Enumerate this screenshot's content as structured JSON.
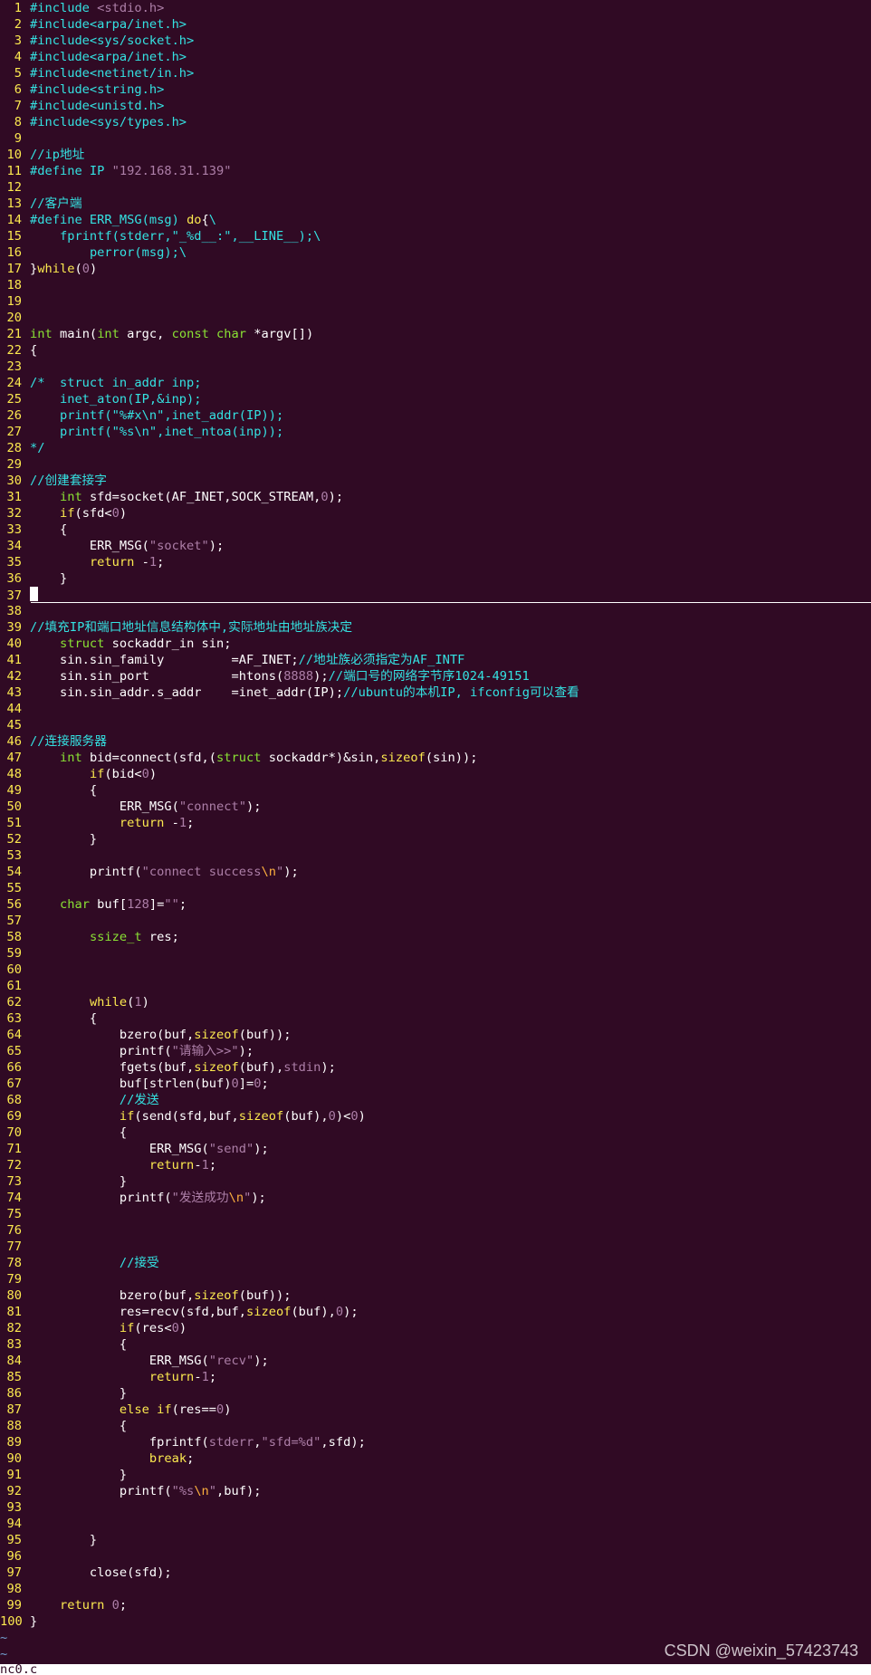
{
  "editor": {
    "filename": "nc0.c",
    "cursor_line": 37,
    "lines": [
      [
        [
          "pp",
          "#include "
        ],
        [
          "st",
          "<stdio.h>"
        ]
      ],
      [
        [
          "pp",
          "#include<arpa/inet.h>"
        ]
      ],
      [
        [
          "pp",
          "#include<sys/socket.h>"
        ]
      ],
      [
        [
          "pp",
          "#include<arpa/inet.h>"
        ]
      ],
      [
        [
          "pp",
          "#include<netinet/in.h>"
        ]
      ],
      [
        [
          "pp",
          "#include<string.h>"
        ]
      ],
      [
        [
          "pp",
          "#include<unistd.h>"
        ]
      ],
      [
        [
          "pp",
          "#include<sys/types.h>"
        ]
      ],
      [],
      [
        [
          "cm",
          "//ip地址"
        ]
      ],
      [
        [
          "pp",
          "#define IP "
        ],
        [
          "st",
          "\"192.168.31.139\""
        ]
      ],
      [],
      [
        [
          "cm",
          "//客户端"
        ]
      ],
      [
        [
          "pp",
          "#define ERR_MSG(msg) "
        ],
        [
          "kw",
          "do"
        ],
        [
          "tx",
          "{"
        ],
        [
          "pp",
          "\\"
        ]
      ],
      [
        [
          "tx",
          "    "
        ],
        [
          "pp",
          "fprintf(stderr,\"_%d__:\",__LINE__);\\"
        ]
      ],
      [
        [
          "tx",
          "        "
        ],
        [
          "pp",
          "perror(msg);\\"
        ]
      ],
      [
        [
          "tx",
          "}"
        ],
        [
          "kw",
          "while"
        ],
        [
          "tx",
          "("
        ],
        [
          "nu",
          "0"
        ],
        [
          "tx",
          ")"
        ]
      ],
      [],
      [],
      [],
      [
        [
          "ty",
          "int"
        ],
        [
          "tx",
          " main("
        ],
        [
          "ty",
          "int"
        ],
        [
          "tx",
          " argc, "
        ],
        [
          "ty",
          "const char"
        ],
        [
          "tx",
          " *argv[])"
        ]
      ],
      [
        [
          "tx",
          "{"
        ]
      ],
      [],
      [
        [
          "cm",
          "/*  struct in_addr inp;"
        ]
      ],
      [
        [
          "cm",
          "    inet_aton(IP,&inp);"
        ]
      ],
      [
        [
          "cm",
          "    printf(\"%#x\\n\",inet_addr(IP));"
        ]
      ],
      [
        [
          "cm",
          "    printf(\"%s\\n\",inet_ntoa(inp));"
        ]
      ],
      [
        [
          "cm",
          "*/"
        ]
      ],
      [],
      [
        [
          "cm",
          "//创建套接字"
        ]
      ],
      [
        [
          "tx",
          "    "
        ],
        [
          "ty",
          "int"
        ],
        [
          "tx",
          " sfd=socket(AF_INET,SOCK_STREAM,"
        ],
        [
          "nu",
          "0"
        ],
        [
          "tx",
          ");"
        ]
      ],
      [
        [
          "tx",
          "    "
        ],
        [
          "kw",
          "if"
        ],
        [
          "tx",
          "(sfd<"
        ],
        [
          "nu",
          "0"
        ],
        [
          "tx",
          ")"
        ]
      ],
      [
        [
          "tx",
          "    {"
        ]
      ],
      [
        [
          "tx",
          "        ERR_MSG("
        ],
        [
          "st",
          "\"socket\""
        ],
        [
          "tx",
          ");"
        ]
      ],
      [
        [
          "tx",
          "        "
        ],
        [
          "kw",
          "return"
        ],
        [
          "tx",
          " -"
        ],
        [
          "nu",
          "1"
        ],
        [
          "tx",
          ";"
        ]
      ],
      [
        [
          "tx",
          "    }"
        ]
      ],
      [],
      [],
      [
        [
          "cm",
          "//填充IP和端口地址信息结构体中,实际地址由地址族决定"
        ]
      ],
      [
        [
          "tx",
          "    "
        ],
        [
          "ty",
          "struct"
        ],
        [
          "tx",
          " sockaddr_in sin;"
        ]
      ],
      [
        [
          "tx",
          "    sin.sin_family         =AF_INET;"
        ],
        [
          "cm",
          "//地址族必须指定为AF_INTF"
        ]
      ],
      [
        [
          "tx",
          "    sin.sin_port           =htons("
        ],
        [
          "nu",
          "8888"
        ],
        [
          "tx",
          ");"
        ],
        [
          "cm",
          "//端口号的网络字节序1024-49151"
        ]
      ],
      [
        [
          "tx",
          "    sin.sin_addr.s_addr    =inet_addr(IP);"
        ],
        [
          "cm",
          "//ubuntu的本机IP, ifconfig可以查看"
        ]
      ],
      [],
      [],
      [
        [
          "cm",
          "//连接服务器"
        ]
      ],
      [
        [
          "tx",
          "    "
        ],
        [
          "ty",
          "int"
        ],
        [
          "tx",
          " bid=connect(sfd,("
        ],
        [
          "ty",
          "struct"
        ],
        [
          "tx",
          " sockaddr*)&sin,"
        ],
        [
          "kw",
          "sizeof"
        ],
        [
          "tx",
          "(sin));"
        ]
      ],
      [
        [
          "tx",
          "        "
        ],
        [
          "kw",
          "if"
        ],
        [
          "tx",
          "(bid<"
        ],
        [
          "nu",
          "0"
        ],
        [
          "tx",
          ")"
        ]
      ],
      [
        [
          "tx",
          "        {"
        ]
      ],
      [
        [
          "tx",
          "            ERR_MSG("
        ],
        [
          "st",
          "\"connect\""
        ],
        [
          "tx",
          ");"
        ]
      ],
      [
        [
          "tx",
          "            "
        ],
        [
          "kw",
          "return"
        ],
        [
          "tx",
          " -"
        ],
        [
          "nu",
          "1"
        ],
        [
          "tx",
          ";"
        ]
      ],
      [
        [
          "tx",
          "        }"
        ]
      ],
      [],
      [
        [
          "tx",
          "        printf("
        ],
        [
          "st",
          "\"connect success"
        ],
        [
          "sp",
          "\\n"
        ],
        [
          "st",
          "\""
        ],
        [
          "tx",
          ");"
        ]
      ],
      [],
      [
        [
          "tx",
          "    "
        ],
        [
          "ty",
          "char"
        ],
        [
          "tx",
          " buf["
        ],
        [
          "nu",
          "128"
        ],
        [
          "tx",
          "]="
        ],
        [
          "st",
          "\"\""
        ],
        [
          "tx",
          ";"
        ]
      ],
      [],
      [
        [
          "tx",
          "        "
        ],
        [
          "ty",
          "ssize_t"
        ],
        [
          "tx",
          " res;"
        ]
      ],
      [],
      [],
      [],
      [
        [
          "tx",
          "        "
        ],
        [
          "kw",
          "while"
        ],
        [
          "tx",
          "("
        ],
        [
          "nu",
          "1"
        ],
        [
          "tx",
          ")"
        ]
      ],
      [
        [
          "tx",
          "        {"
        ]
      ],
      [
        [
          "tx",
          "            bzero(buf,"
        ],
        [
          "kw",
          "sizeof"
        ],
        [
          "tx",
          "(buf));"
        ]
      ],
      [
        [
          "tx",
          "            printf("
        ],
        [
          "st",
          "\"请输入>>\""
        ],
        [
          "tx",
          ");"
        ]
      ],
      [
        [
          "tx",
          "            fgets(buf,"
        ],
        [
          "kw",
          "sizeof"
        ],
        [
          "tx",
          "(buf),"
        ],
        [
          "st",
          "stdin"
        ],
        [
          "tx",
          ");"
        ]
      ],
      [
        [
          "tx",
          "            buf[strlen(buf)"
        ],
        [
          "nu",
          "0"
        ],
        [
          "tx",
          "]="
        ],
        [
          "nu",
          "0"
        ],
        [
          "tx",
          ";"
        ]
      ],
      [
        [
          "tx",
          "            "
        ],
        [
          "cm",
          "//发送"
        ]
      ],
      [
        [
          "tx",
          "            "
        ],
        [
          "kw",
          "if"
        ],
        [
          "tx",
          "(send(sfd,buf,"
        ],
        [
          "kw",
          "sizeof"
        ],
        [
          "tx",
          "(buf),"
        ],
        [
          "nu",
          "0"
        ],
        [
          "tx",
          ")<"
        ],
        [
          "nu",
          "0"
        ],
        [
          "tx",
          ")"
        ]
      ],
      [
        [
          "tx",
          "            {"
        ]
      ],
      [
        [
          "tx",
          "                ERR_MSG("
        ],
        [
          "st",
          "\"send\""
        ],
        [
          "tx",
          ");"
        ]
      ],
      [
        [
          "tx",
          "                "
        ],
        [
          "kw",
          "return"
        ],
        [
          "tx",
          "-"
        ],
        [
          "nu",
          "1"
        ],
        [
          "tx",
          ";"
        ]
      ],
      [
        [
          "tx",
          "            }"
        ]
      ],
      [
        [
          "tx",
          "            printf("
        ],
        [
          "st",
          "\"发送成功"
        ],
        [
          "sp",
          "\\n"
        ],
        [
          "st",
          "\""
        ],
        [
          "tx",
          ");"
        ]
      ],
      [],
      [],
      [],
      [
        [
          "tx",
          "            "
        ],
        [
          "cm",
          "//接受"
        ]
      ],
      [],
      [
        [
          "tx",
          "            bzero(buf,"
        ],
        [
          "kw",
          "sizeof"
        ],
        [
          "tx",
          "(buf));"
        ]
      ],
      [
        [
          "tx",
          "            res=recv(sfd,buf,"
        ],
        [
          "kw",
          "sizeof"
        ],
        [
          "tx",
          "(buf),"
        ],
        [
          "nu",
          "0"
        ],
        [
          "tx",
          ");"
        ]
      ],
      [
        [
          "tx",
          "            "
        ],
        [
          "kw",
          "if"
        ],
        [
          "tx",
          "(res<"
        ],
        [
          "nu",
          "0"
        ],
        [
          "tx",
          ")"
        ]
      ],
      [
        [
          "tx",
          "            {"
        ]
      ],
      [
        [
          "tx",
          "                ERR_MSG("
        ],
        [
          "st",
          "\"recv\""
        ],
        [
          "tx",
          ");"
        ]
      ],
      [
        [
          "tx",
          "                "
        ],
        [
          "kw",
          "return"
        ],
        [
          "tx",
          "-"
        ],
        [
          "nu",
          "1"
        ],
        [
          "tx",
          ";"
        ]
      ],
      [
        [
          "tx",
          "            }"
        ]
      ],
      [
        [
          "tx",
          "            "
        ],
        [
          "kw",
          "else if"
        ],
        [
          "tx",
          "(res=="
        ],
        [
          "nu",
          "0"
        ],
        [
          "tx",
          ")"
        ]
      ],
      [
        [
          "tx",
          "            {"
        ]
      ],
      [
        [
          "tx",
          "                fprintf("
        ],
        [
          "st",
          "stderr"
        ],
        [
          "tx",
          ","
        ],
        [
          "st",
          "\"sfd=%d\""
        ],
        [
          "tx",
          ",sfd);"
        ]
      ],
      [
        [
          "tx",
          "                "
        ],
        [
          "kw",
          "break"
        ],
        [
          "tx",
          ";"
        ]
      ],
      [
        [
          "tx",
          "            }"
        ]
      ],
      [
        [
          "tx",
          "            printf("
        ],
        [
          "st",
          "\"%s"
        ],
        [
          "sp",
          "\\n"
        ],
        [
          "st",
          "\""
        ],
        [
          "tx",
          ",buf);"
        ]
      ],
      [],
      [],
      [
        [
          "tx",
          "        }"
        ]
      ],
      [],
      [
        [
          "tx",
          "        close(sfd);"
        ]
      ],
      [],
      [
        [
          "tx",
          "    "
        ],
        [
          "kw",
          "return"
        ],
        [
          "tx",
          " "
        ],
        [
          "nu",
          "0"
        ],
        [
          "tx",
          ";"
        ]
      ],
      [
        [
          "tx",
          "}"
        ]
      ]
    ]
  },
  "tilde_glyph": "~",
  "tilde_count": 2,
  "watermark": "CSDN @weixin_57423743"
}
